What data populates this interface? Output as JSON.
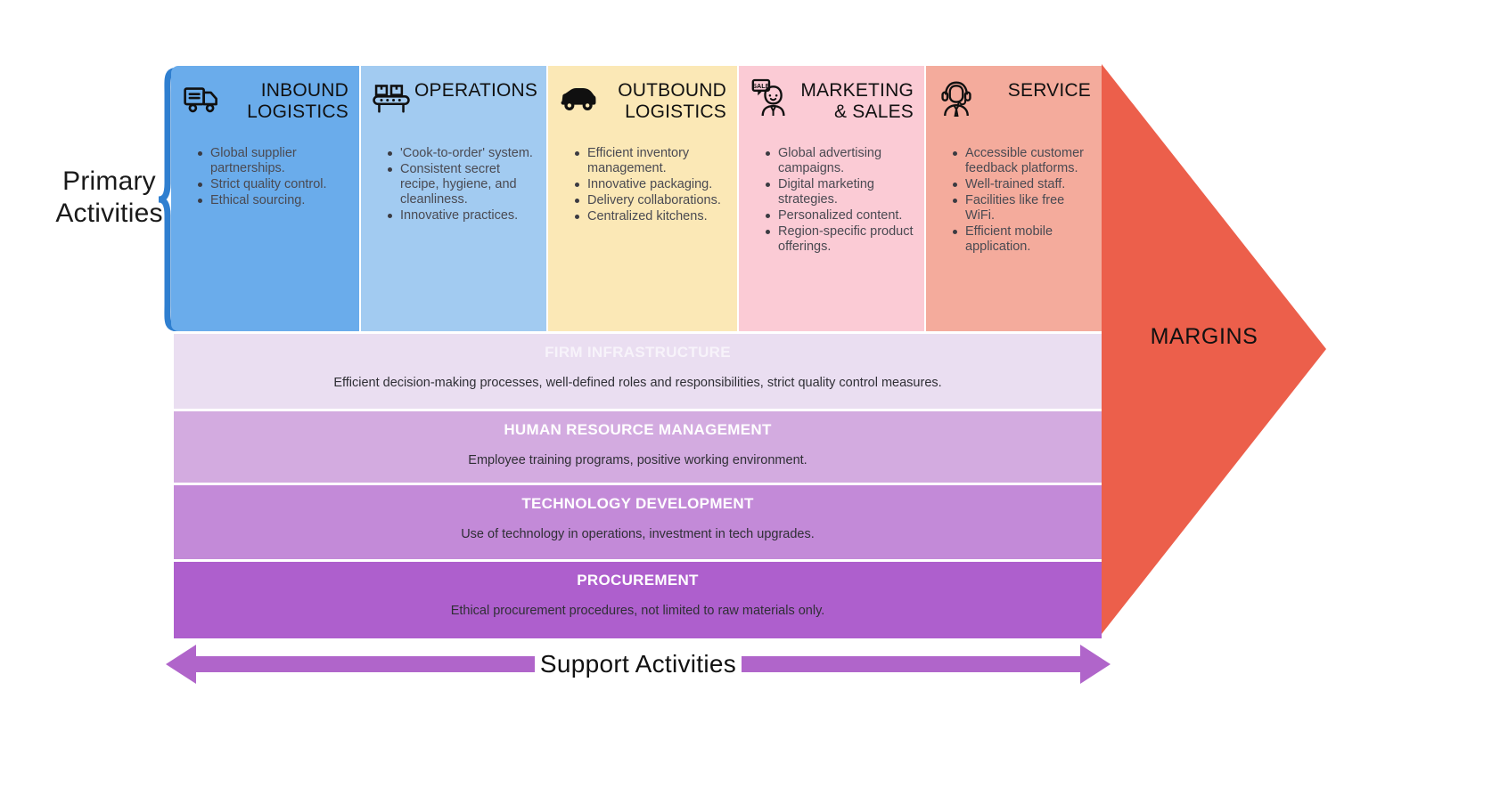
{
  "diagram": {
    "primary_label": "Primary\nActivities",
    "margins_label": "MARGINS",
    "support_arrow_label": "Support  Activities"
  },
  "colors": {
    "inbound": "#6aaceb",
    "operations": "#a2cbf1",
    "outbound": "#fbe8b6",
    "marketing": "#fbcbd5",
    "service": "#f4ab9c",
    "brace": "#2f7fd0",
    "margins_arrow": "#ec5f4b",
    "support_arrow": "#b065ca",
    "band_1": "#eadef1",
    "band_2": "#d3abe0",
    "band_3": "#c38ad8",
    "band_4": "#ae5fcd"
  },
  "primary_activities": [
    {
      "id": "inbound-logistics",
      "icon": "truck-icon",
      "title": "INBOUND\nLOGISTICS",
      "bullets": [
        "Global supplier partnerships.",
        "Strict quality control.",
        "Ethical sourcing."
      ]
    },
    {
      "id": "operations",
      "icon": "conveyor-belt-icon",
      "title": "OPERATIONS",
      "bullets": [
        "'Cook-to-order' system.",
        "Consistent secret recipe, hygiene, and cleanliness.",
        "Innovative practices."
      ]
    },
    {
      "id": "outbound-logistics",
      "icon": "car-icon",
      "title": "OUTBOUND\nLOGISTICS",
      "bullets": [
        "Efficient inventory management.",
        "Innovative packaging.",
        "Delivery collaborations.",
        "Centralized kitchens."
      ]
    },
    {
      "id": "marketing-and-sales",
      "icon": "salesperson-sale-icon",
      "title": "MARKETING\n& SALES",
      "bullets": [
        "Global advertising campaigns.",
        "Digital marketing strategies.",
        "Personalized content.",
        "Region-specific product offerings."
      ]
    },
    {
      "id": "service",
      "icon": "headset-agent-icon",
      "title": "SERVICE",
      "bullets": [
        "Accessible customer feedback platforms.",
        "Well-trained staff.",
        "Facilities like free WiFi.",
        "Efficient mobile application."
      ]
    }
  ],
  "support_activities": [
    {
      "id": "firm-infrastructure",
      "title": "FIRM INFRASTRUCTURE",
      "description": "Efficient decision-making processes, well-defined roles and responsibilities, strict quality control measures."
    },
    {
      "id": "human-resource-management",
      "title": "HUMAN RESOURCE MANAGEMENT",
      "description": "Employee training programs, positive working environment."
    },
    {
      "id": "technology-development",
      "title": "TECHNOLOGY DEVELOPMENT",
      "description": "Use of technology in operations, investment in tech upgrades."
    },
    {
      "id": "procurement",
      "title": "PROCUREMENT",
      "description": "Ethical procurement procedures, not limited to raw materials only."
    }
  ]
}
